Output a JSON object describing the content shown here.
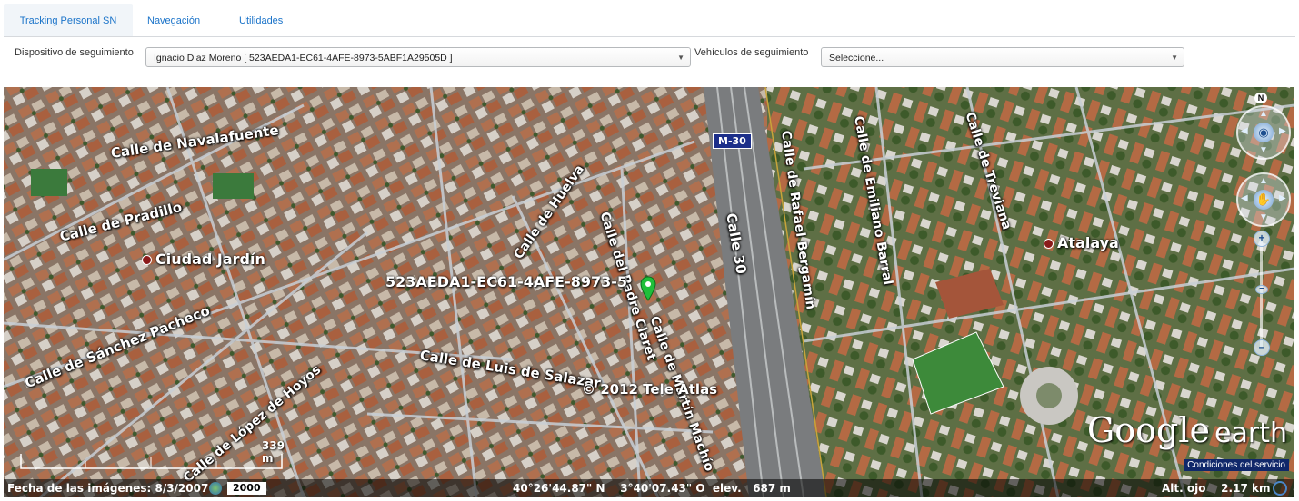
{
  "tabs": [
    {
      "label": "Tracking Personal SN",
      "active": true
    },
    {
      "label": "Navegación",
      "active": false
    },
    {
      "label": "Utilidades",
      "active": false
    }
  ],
  "toolbar": {
    "device_label": "Dispositivo de seguimiento",
    "device_value": "Ignacio Diaz Moreno [ 523AEDA1-EC61-4AFE-8973-5ABF1A29505D ]",
    "vehicle_label": "Vehículos de seguimiento",
    "vehicle_value": "Seleccione..."
  },
  "map": {
    "streets": [
      "Calle de Navalafuente",
      "Calle de Pradillo",
      "Calle de Huelva",
      "Calle del Padre Claret",
      "Calle de Martín Machío",
      "Calle de Luis de Salazar",
      "Calle de Sánchez Pacheco",
      "Calle de López de Hoyos",
      "Calle 30",
      "Calle de Rafael Bergamín",
      "Calle de Emiliano Barral",
      "Calle de Treviana"
    ],
    "places": [
      "Ciudad Jardín",
      "Atalaya"
    ],
    "highway_shield": "M-30",
    "device_marker_label": "523AEDA1-EC61-4AFE-8973-5",
    "copyright": "© 2012 Tele Atlas",
    "logo_google": "Google",
    "logo_earth": "earth",
    "terms": "Condiciones del servicio",
    "north": "N",
    "scale_label": "339 m",
    "status": {
      "imagery_date": "Fecha de las imágenes: 8/3/2007",
      "year": "2000",
      "coords": "40°26'44.87\" N    3°40'07.43\" O  elev.   687 m",
      "eye_alt": "Alt. ojo    2.17 km"
    }
  },
  "colors": {
    "tab_text": "#1a73c9",
    "marker": "#1fbf3a",
    "shield": "#1c2f8a"
  }
}
